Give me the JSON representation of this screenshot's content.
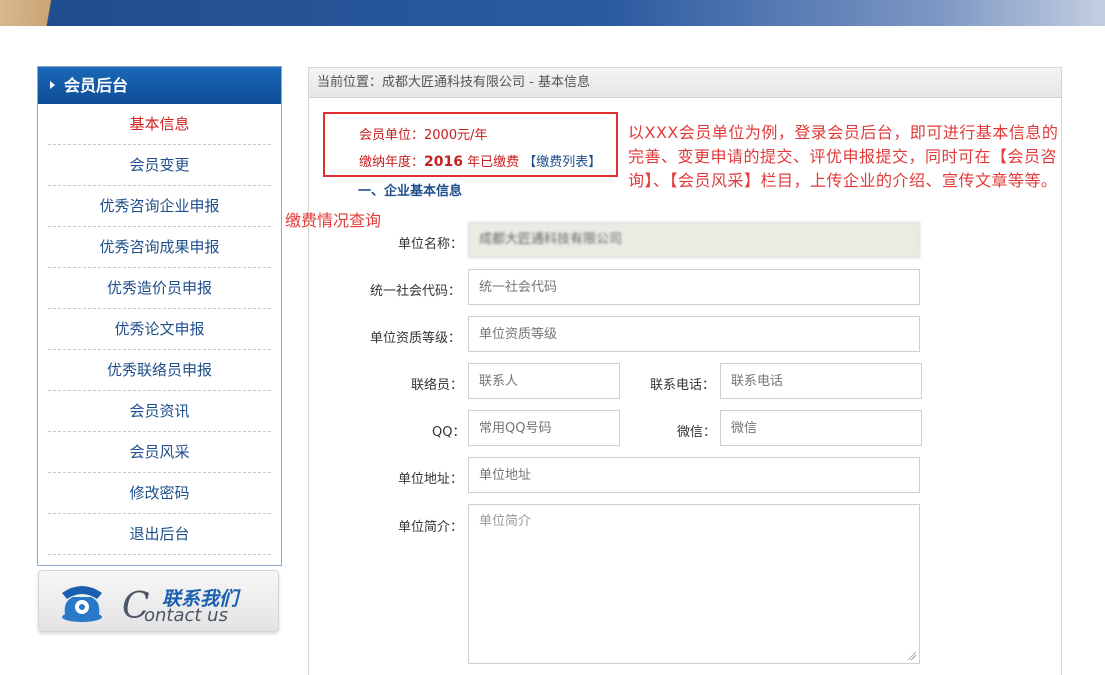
{
  "sidebar": {
    "title": "会员后台",
    "items": [
      {
        "label": "基本信息",
        "active": true
      },
      {
        "label": "会员变更"
      },
      {
        "label": "优秀咨询企业申报"
      },
      {
        "label": "优秀咨询成果申报"
      },
      {
        "label": "优秀造价员申报"
      },
      {
        "label": "优秀论文申报"
      },
      {
        "label": "优秀联络员申报"
      },
      {
        "label": "会员资讯"
      },
      {
        "label": "会员风采"
      },
      {
        "label": "修改密码"
      },
      {
        "label": "退出后台"
      }
    ]
  },
  "contact": {
    "cn_label": "联系我们",
    "en_big_letter": "C",
    "en_rest": "ontact us"
  },
  "breadcrumb": "当前位置：成都大匠通科技有限公司 - 基本信息",
  "fee_box": {
    "member_unit_label": "会员单位：",
    "member_unit_value": "2000元/年",
    "fee_year_label": "缴纳年度：",
    "fee_year": "2016",
    "fee_status": "年已缴费",
    "fee_list_link": "【缴费列表】"
  },
  "section_title": "一、企业基本信息",
  "annotations": {
    "right_note": "以XXX会员单位为例，登录会员后台，即可进行基本信息的完善、变更申请的提交、评优申报提交，同时可在【会员咨询】、【会员风采】栏目，上传企业的介绍、宣传文章等等。",
    "left_note": "缴费情况查询"
  },
  "form": {
    "company_name": {
      "label": "单位名称：",
      "value": "成都大匠通科技有限公司"
    },
    "credit_code": {
      "label": "统一社会代码：",
      "placeholder": "统一社会代码"
    },
    "qualification": {
      "label": "单位资质等级：",
      "placeholder": "单位资质等级"
    },
    "contact_person": {
      "label": "联络员：",
      "placeholder": "联系人"
    },
    "contact_phone": {
      "label": "联系电话：",
      "placeholder": "联系电话"
    },
    "qq": {
      "label": "QQ：",
      "placeholder": "常用QQ号码"
    },
    "wechat": {
      "label": "微信：",
      "placeholder": "微信"
    },
    "address": {
      "label": "单位地址：",
      "placeholder": "单位地址"
    },
    "intro": {
      "label": "单位简介：",
      "placeholder": "单位简介"
    }
  },
  "colors": {
    "header_blue": "#0e4d96",
    "link_blue": "#1f4f8c",
    "annotation_red": "#e23a3a",
    "active_red": "#d62020"
  }
}
